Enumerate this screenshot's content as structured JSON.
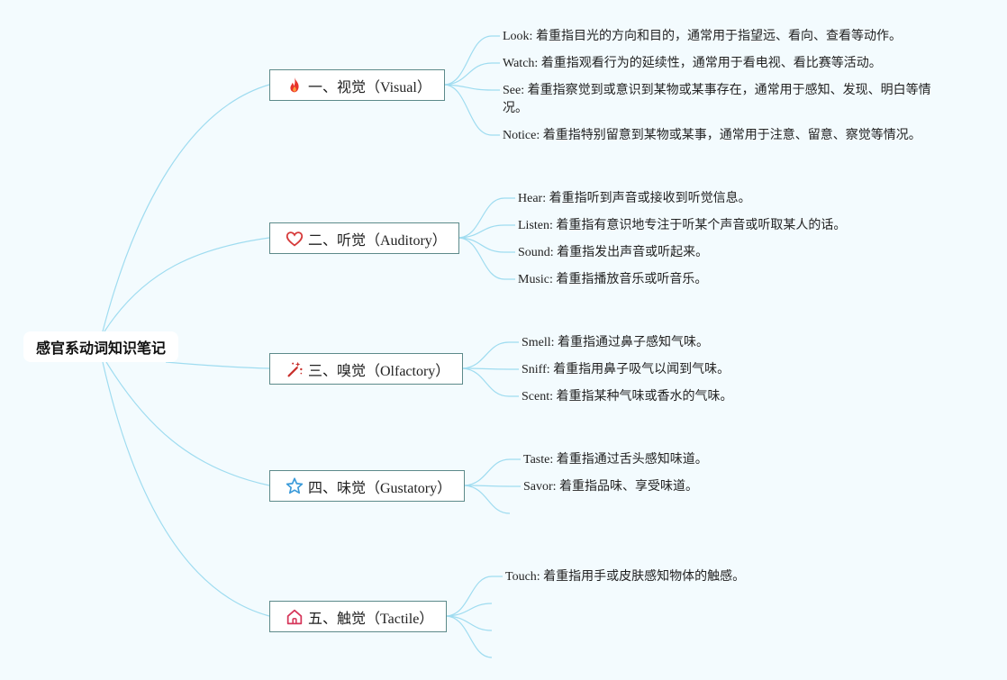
{
  "root": {
    "label": "感官系动词知识笔记"
  },
  "branches": [
    {
      "label": "一、视觉（Visual）",
      "icon": "fire-icon",
      "items": [
        "Look: 着重指目光的方向和目的，通常用于指望远、看向、查看等动作。",
        "Watch: 着重指观看行为的延续性，通常用于看电视、看比赛等活动。",
        "See: 着重指察觉到或意识到某物或某事存在，通常用于感知、发现、明白等情况。",
        "Notice: 着重指特别留意到某物或某事，通常用于注意、留意、察觉等情况。"
      ]
    },
    {
      "label": "二、听觉（Auditory）",
      "icon": "heart-icon",
      "items": [
        "Hear: 着重指听到声音或接收到听觉信息。",
        "Listen: 着重指有意识地专注于听某个声音或听取某人的话。",
        "Sound: 着重指发出声音或听起来。",
        "Music: 着重指播放音乐或听音乐。"
      ]
    },
    {
      "label": "三、嗅觉（Olfactory）",
      "icon": "magic-wand-icon",
      "items": [
        "Smell: 着重指通过鼻子感知气味。",
        "Sniff: 着重指用鼻子吸气以闻到气味。",
        "Scent: 着重指某种气味或香水的气味。"
      ]
    },
    {
      "label": "四、味觉（Gustatory）",
      "icon": "star-icon",
      "items": [
        "Taste: 着重指通过舌头感知味道。",
        "Savor: 着重指品味、享受味道。",
        ""
      ]
    },
    {
      "label": "五、触觉（Tactile）",
      "icon": "home-icon",
      "items": [
        "Touch: 着重指用手或皮肤感知物体的触感。",
        "",
        "",
        ""
      ]
    }
  ],
  "colors": {
    "background": "#f3fbfe",
    "link": "#9fdcf0",
    "branch_border": "#5c8a8a",
    "fire": "#e8332a",
    "heart": "#d63a3a",
    "wand": "#c8302c",
    "star": "#3a9ad9",
    "home": "#d6365a"
  }
}
